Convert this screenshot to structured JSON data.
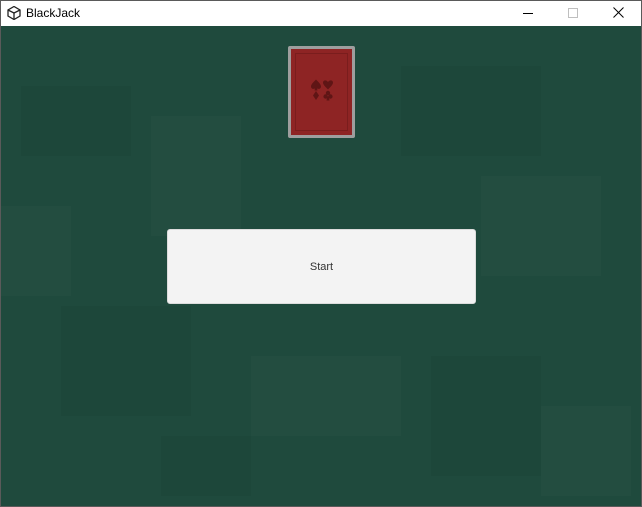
{
  "window": {
    "title": "BlackJack",
    "app_icon": "unity-logo-icon",
    "controls": {
      "minimize_icon": "minimize-icon",
      "maximize_icon": "maximize-icon",
      "close_icon": "close-icon"
    }
  },
  "game": {
    "background_color": "#1f4a3d",
    "deck": {
      "icon": "card-back-icon",
      "back_color": "#8e2424"
    },
    "start_button": {
      "label": "Start"
    }
  }
}
